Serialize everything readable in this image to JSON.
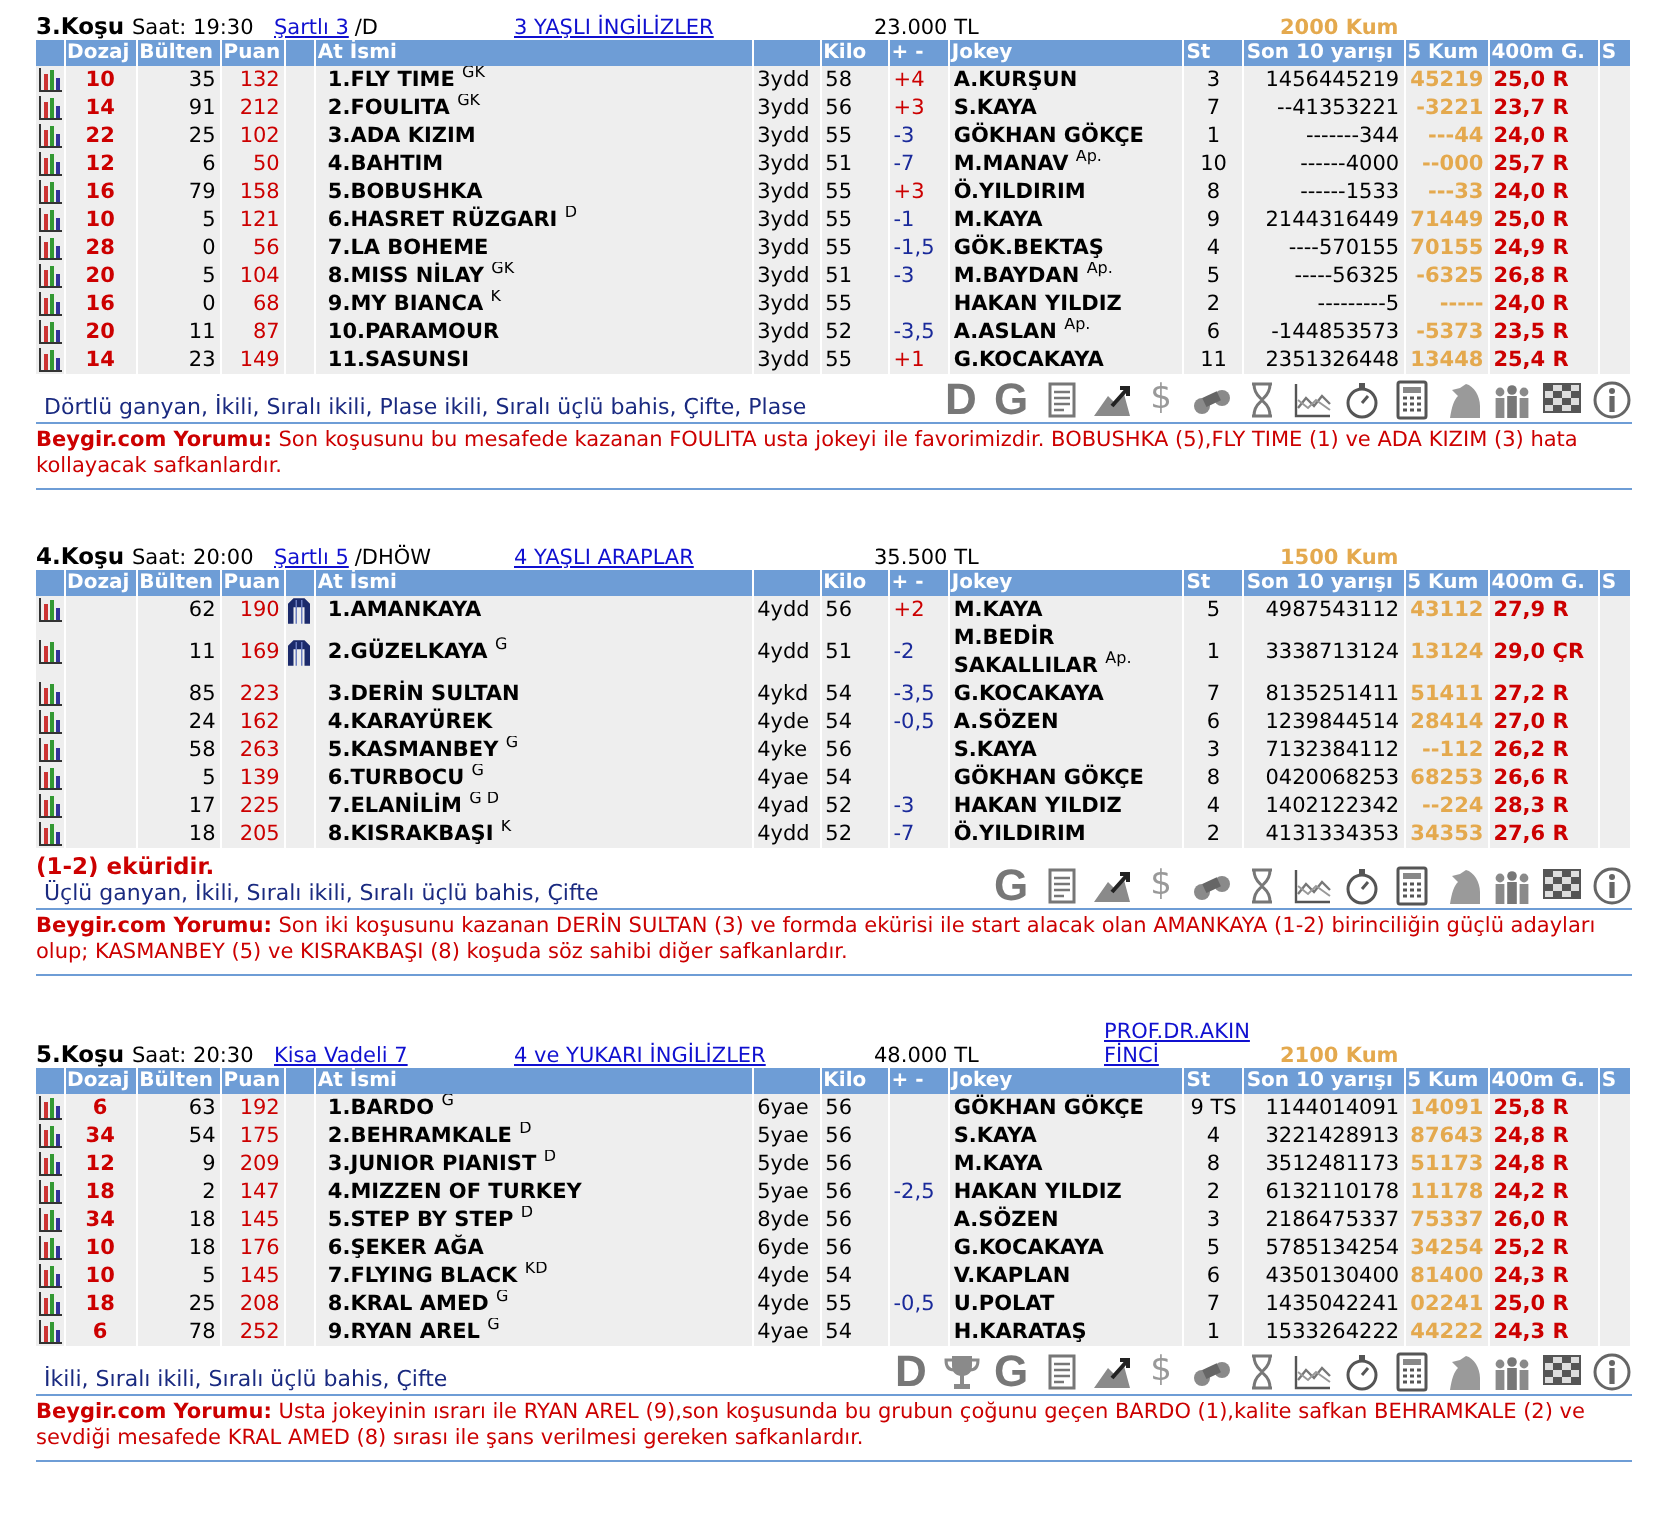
{
  "races": [
    {
      "header": {
        "number": "3.Koşu",
        "time": "Saat: 19:30",
        "condition_link": "Şartlı 3",
        "condition_suffix": "/D",
        "breed_link": "3 YAŞLI İNGİLİZLER",
        "prize": "23.000 TL",
        "distance": "2000 Kum"
      },
      "columns": [
        "Dozaj",
        "Bülten",
        "Puan",
        "At İsmi",
        "Kilo",
        "+ -",
        "Jokey",
        "St",
        "Son 10 yarışı",
        "5 Kum",
        "400m G.",
        "S"
      ],
      "rows": [
        {
          "dozaj": "10",
          "bulten": "35",
          "puan": "132",
          "silks": false,
          "name": "1.FLY TIME $^{GK}$",
          "age": "3ydd",
          "kilo": "58",
          "diff": "+4",
          "increase": true,
          "jockey": "A.KURŞUN",
          "st": "3",
          "son10": "1456445219",
          "kum5": "45219",
          "g400": "25,0 R"
        },
        {
          "dozaj": "14",
          "bulten": "91",
          "puan": "212",
          "silks": false,
          "name": "2.FOULITA $^{GK}$",
          "age": "3ydd",
          "kilo": "56",
          "diff": "+3",
          "increase": true,
          "jockey": "S.KAYA",
          "st": "7",
          "son10": "--41353221",
          "kum5": "-3221",
          "g400": "23,7 R"
        },
        {
          "dozaj": "22",
          "bulten": "25",
          "puan": "102",
          "silks": false,
          "name": "3.ADA KIZIM",
          "age": "3ydd",
          "kilo": "55",
          "diff": "-3",
          "increase": false,
          "jockey": "GÖKHAN GÖKÇE",
          "st": "1",
          "son10": "-------344",
          "kum5": "---44",
          "g400": "24,0 R"
        },
        {
          "dozaj": "12",
          "bulten": "6",
          "puan": "50",
          "silks": false,
          "name": "4.BAHTIM",
          "age": "3ydd",
          "kilo": "51",
          "diff": "-7",
          "increase": false,
          "jockey": "M.MANAV $^{Ap.}$",
          "st": "10",
          "son10": "------4000",
          "kum5": "--000",
          "g400": "25,7 R"
        },
        {
          "dozaj": "16",
          "bulten": "79",
          "puan": "158",
          "silks": false,
          "name": "5.BOBUSHKA",
          "age": "3ydd",
          "kilo": "55",
          "diff": "+3",
          "increase": true,
          "jockey": "Ö.YILDIRIM",
          "st": "8",
          "son10": "------1533",
          "kum5": "---33",
          "g400": "24,0 R"
        },
        {
          "dozaj": "10",
          "bulten": "5",
          "puan": "121",
          "silks": false,
          "name": "6.HASRET RÜZGARI $^{D}$",
          "age": "3ydd",
          "kilo": "55",
          "diff": "-1",
          "increase": false,
          "jockey": "M.KAYA",
          "st": "9",
          "son10": "2144316449",
          "kum5": "71449",
          "g400": "25,0 R"
        },
        {
          "dozaj": "28",
          "bulten": "0",
          "puan": "56",
          "silks": false,
          "name": "7.LA BOHEME",
          "age": "3ydd",
          "kilo": "55",
          "diff": "-1,5",
          "increase": false,
          "jockey": "GÖK.BEKTAŞ",
          "st": "4",
          "son10": "----570155",
          "kum5": "70155",
          "g400": "24,9 R"
        },
        {
          "dozaj": "20",
          "bulten": "5",
          "puan": "104",
          "silks": false,
          "name": "8.MISS NİLAY $^{GK}$",
          "age": "3ydd",
          "kilo": "51",
          "diff": "-3",
          "increase": false,
          "jockey": "M.BAYDAN $^{Ap.}$",
          "st": "5",
          "son10": "-----56325",
          "kum5": "-6325",
          "g400": "26,8 R"
        },
        {
          "dozaj": "16",
          "bulten": "0",
          "puan": "68",
          "silks": false,
          "name": "9.MY BIANCA $^{K}$",
          "age": "3ydd",
          "kilo": "55",
          "jockey": "HAKAN YILDIZ",
          "st": "2",
          "son10": "---------5",
          "kum5": "-----",
          "g400": "24,0 R"
        },
        {
          "dozaj": "20",
          "bulten": "11",
          "puan": "87",
          "silks": false,
          "name": "10.PARAMOUR",
          "age": "3ydd",
          "kilo": "52",
          "diff": "-3,5",
          "increase": false,
          "jockey": "A.ASLAN $^{Ap.}$",
          "st": "6",
          "son10": "-144853573",
          "kum5": "-5373",
          "g400": "23,5 R"
        },
        {
          "dozaj": "14",
          "bulten": "23",
          "puan": "149",
          "silks": false,
          "name": "11.SASUNSI",
          "age": "3ydd",
          "kilo": "55",
          "diff": "+1",
          "increase": true,
          "jockey": "G.KOCAKAYA",
          "st": "11",
          "son10": "2351326448",
          "kum5": "13448",
          "g400": "25,4 R"
        }
      ],
      "bet_types": "Dörtlü ganyan, İkili, Sıralı ikili, Plase ikili, Sıralı üçlü bahis, Çifte, Plase",
      "tools": [
        {
          "kind": "letter",
          "text": "D"
        },
        {
          "kind": "letter",
          "text": "G"
        },
        {
          "kind": "form"
        },
        {
          "kind": "trend"
        },
        {
          "kind": "glyph",
          "text": "$"
        },
        {
          "kind": "binoculars"
        },
        {
          "kind": "hourglass"
        },
        {
          "kind": "linechart"
        },
        {
          "kind": "stopwatch"
        },
        {
          "kind": "calculator"
        },
        {
          "kind": "horse"
        },
        {
          "kind": "people"
        },
        {
          "kind": "flag"
        },
        {
          "kind": "info"
        }
      ],
      "comment": "**Beygir.com Yorumu:** Son koşusunu bu mesafede kazanan FOULITA usta jokeyi ile favorimizdir. BOBUSHKA (5),FLY TIME (1) ve ADA KIZIM (3) hata kollayacak safkanlardır."
    },
    {
      "header": {
        "number": "4.Koşu",
        "time": "Saat: 20:00",
        "condition_link": "Şartlı 5",
        "condition_suffix": "/DHÖW",
        "breed_link": "4 YAŞLI ARAPLAR",
        "prize": "35.500 TL",
        "distance": "1500 Kum"
      },
      "columns": [
        "Dozaj",
        "Bülten",
        "Puan",
        "At İsmi",
        "Kilo",
        "+ -",
        "Jokey",
        "St",
        "Son 10 yarışı",
        "5 Kum",
        "400m G.",
        "S"
      ],
      "rows": [
        {
          "bulten": "62",
          "puan": "190",
          "silks": true,
          "name": "1.AMANKAYA",
          "age": "4ydd",
          "kilo": "56",
          "diff": "+2",
          "increase": true,
          "jockey": "M.KAYA",
          "st": "5",
          "son10": "4987543112",
          "kum5": "43112",
          "g400": "27,9 R"
        },
        {
          "bulten": "11",
          "puan": "169",
          "silks": true,
          "name": "2.GÜZELKAYA $^{G}$",
          "age": "4ydd",
          "kilo": "51",
          "diff": "-2",
          "increase": false,
          "jockey": "M.BEDİR SAKALLILAR $^{Ap.}$",
          "st": "1",
          "son10": "3338713124",
          "kum5": "13124",
          "g400": "29,0 ÇR"
        },
        {
          "bulten": "85",
          "puan": "223",
          "silks": false,
          "name": "3.DERİN SULTAN",
          "age": "4ykd",
          "kilo": "54",
          "diff": "-3,5",
          "increase": false,
          "jockey": "G.KOCAKAYA",
          "st": "7",
          "son10": "8135251411",
          "kum5": "51411",
          "g400": "27,2 R"
        },
        {
          "bulten": "24",
          "puan": "162",
          "silks": false,
          "name": "4.KARAYÜREK",
          "age": "4yde",
          "kilo": "54",
          "diff": "-0,5",
          "increase": false,
          "jockey": "A.SÖZEN",
          "st": "6",
          "son10": "1239844514",
          "kum5": "28414",
          "g400": "27,0 R"
        },
        {
          "bulten": "58",
          "puan": "263",
          "silks": false,
          "name": "5.KASMANBEY $^{G}$",
          "age": "4yke",
          "kilo": "56",
          "jockey": "S.KAYA",
          "st": "3",
          "son10": "7132384112",
          "kum5": "--112",
          "g400": "26,2 R"
        },
        {
          "bulten": "5",
          "puan": "139",
          "silks": false,
          "name": "6.TURBOCU $^{G}$",
          "age": "4yae",
          "kilo": "54",
          "jockey": "GÖKHAN GÖKÇE",
          "st": "8",
          "son10": "0420068253",
          "kum5": "68253",
          "g400": "26,6 R"
        },
        {
          "bulten": "17",
          "puan": "225",
          "silks": false,
          "name": "7.ELANİLİM $^{G D}$",
          "age": "4yad",
          "kilo": "52",
          "diff": "-3",
          "increase": false,
          "jockey": "HAKAN YILDIZ",
          "st": "4",
          "son10": "1402122342",
          "kum5": "--224",
          "g400": "28,3 R"
        },
        {
          "bulten": "18",
          "puan": "205",
          "silks": false,
          "name": "8.KISRAKBAŞI $^{K}$",
          "age": "4ydd",
          "kilo": "52",
          "diff": "-7",
          "increase": false,
          "jockey": "Ö.YILDIRIM",
          "st": "2",
          "son10": "4131334353",
          "kum5": "34353",
          "g400": "27,6 R"
        }
      ],
      "note": "(1-2) eküridir.",
      "bet_types": "Üçlü ganyan, İkili, Sıralı ikili, Sıralı üçlü bahis, Çifte",
      "tools": [
        {
          "kind": "letter",
          "text": "G"
        },
        {
          "kind": "form"
        },
        {
          "kind": "trend"
        },
        {
          "kind": "glyph",
          "text": "$"
        },
        {
          "kind": "binoculars"
        },
        {
          "kind": "hourglass"
        },
        {
          "kind": "linechart"
        },
        {
          "kind": "stopwatch"
        },
        {
          "kind": "calculator"
        },
        {
          "kind": "horse"
        },
        {
          "kind": "people"
        },
        {
          "kind": "flag"
        },
        {
          "kind": "info"
        }
      ],
      "comment": "**Beygir.com Yorumu:** Son iki koşusunu kazanan DERİN SULTAN (3) ve formda ekürisi ile start alacak olan AMANKAYA (1-2) birinciliğin güçlü adayları olup; KASMANBEY (5) ve KISRAKBAŞI (8) koşuda söz sahibi diğer safkanlardır."
    },
    {
      "header": {
        "number": "5.Koşu",
        "time": "Saat: 20:30",
        "condition_link": "Kisa Vadeli 7",
        "breed_link": "4 ve YUKARI İNGİLİZLER",
        "prize": "48.000 TL",
        "owner_link": "PROF.DR.AKIN FİNCİ",
        "distance": "2100 Kum"
      },
      "columns": [
        "Dozaj",
        "Bülten",
        "Puan",
        "At İsmi",
        "Kilo",
        "+ -",
        "Jokey",
        "St",
        "Son 10 yarışı",
        "5 Kum",
        "400m G.",
        "S"
      ],
      "rows": [
        {
          "dozaj": "6",
          "bulten": "63",
          "puan": "192",
          "silks": false,
          "name": "1.BARDO $^{G}$",
          "age": "6yae",
          "kilo": "56",
          "jockey": "GÖKHAN GÖKÇE",
          "st": "9 TS",
          "son10": "1144014091",
          "kum5": "14091",
          "g400": "25,8 R"
        },
        {
          "dozaj": "34",
          "bulten": "54",
          "puan": "175",
          "silks": false,
          "name": "2.BEHRAMKALE $^{D}$",
          "age": "5yae",
          "kilo": "56",
          "jockey": "S.KAYA",
          "st": "4",
          "son10": "3221428913",
          "kum5": "87643",
          "g400": "24,8 R"
        },
        {
          "dozaj": "12",
          "bulten": "9",
          "puan": "209",
          "silks": false,
          "name": "3.JUNIOR PIANIST $^{D}$",
          "age": "5yde",
          "kilo": "56",
          "jockey": "M.KAYA",
          "st": "8",
          "son10": "3512481173",
          "kum5": "51173",
          "g400": "24,8 R"
        },
        {
          "dozaj": "18",
          "bulten": "2",
          "puan": "147",
          "silks": false,
          "name": "4.MIZZEN OF TURKEY",
          "age": "5yae",
          "kilo": "56",
          "diff": "-2,5",
          "increase": false,
          "jockey": "HAKAN YILDIZ",
          "st": "2",
          "son10": "6132110178",
          "kum5": "11178",
          "g400": "24,2 R"
        },
        {
          "dozaj": "34",
          "bulten": "18",
          "puan": "145",
          "silks": false,
          "name": "5.STEP BY STEP $^{D}$",
          "age": "8yde",
          "kilo": "56",
          "jockey": "A.SÖZEN",
          "st": "3",
          "son10": "2186475337",
          "kum5": "75337",
          "g400": "26,0 R"
        },
        {
          "dozaj": "10",
          "bulten": "18",
          "puan": "176",
          "silks": false,
          "name": "6.ŞEKER AĞA",
          "age": "6yde",
          "kilo": "56",
          "jockey": "G.KOCAKAYA",
          "st": "5",
          "son10": "5785134254",
          "kum5": "34254",
          "g400": "25,2 R"
        },
        {
          "dozaj": "10",
          "bulten": "5",
          "puan": "145",
          "silks": false,
          "name": "7.FLYING BLACK $^{KD}$",
          "age": "4yde",
          "kilo": "54",
          "jockey": "V.KAPLAN",
          "st": "6",
          "son10": "4350130400",
          "kum5": "81400",
          "g400": "24,3 R"
        },
        {
          "dozaj": "18",
          "bulten": "25",
          "puan": "208",
          "silks": false,
          "name": "8.KRAL AMED $^{G}$",
          "age": "4yde",
          "kilo": "55",
          "diff": "-0,5",
          "increase": false,
          "jockey": "U.POLAT",
          "st": "7",
          "son10": "1435042241",
          "kum5": "02241",
          "g400": "25,0 R"
        },
        {
          "dozaj": "6",
          "bulten": "78",
          "puan": "252",
          "silks": false,
          "name": "9.RYAN AREL $^{G}$",
          "age": "4yae",
          "kilo": "54",
          "jockey": "H.KARATAŞ",
          "st": "1",
          "son10": "1533264222",
          "kum5": "44222",
          "g400": "24,3 R"
        }
      ],
      "bet_types": "İkili, Sıralı ikili, Sıralı üçlü bahis, Çifte",
      "tools": [
        {
          "kind": "letter",
          "text": "D"
        },
        {
          "kind": "trophy"
        },
        {
          "kind": "letter",
          "text": "G"
        },
        {
          "kind": "form"
        },
        {
          "kind": "trend"
        },
        {
          "kind": "glyph",
          "text": "$"
        },
        {
          "kind": "binoculars"
        },
        {
          "kind": "hourglass"
        },
        {
          "kind": "linechart"
        },
        {
          "kind": "stopwatch"
        },
        {
          "kind": "calculator"
        },
        {
          "kind": "horse"
        },
        {
          "kind": "people"
        },
        {
          "kind": "flag"
        },
        {
          "kind": "info"
        }
      ],
      "comment": "**Beygir.com Yorumu:** Usta jokeyinin ısrarı ile RYAN AREL (9),son koşusunda bu grubun çoğunu geçen BARDO (1),kalite safkan BEHRAMKALE (2) ve sevdiği mesafede KRAL AMED (8) sırası ile şans verilmesi gereken safkanlardır."
    }
  ]
}
